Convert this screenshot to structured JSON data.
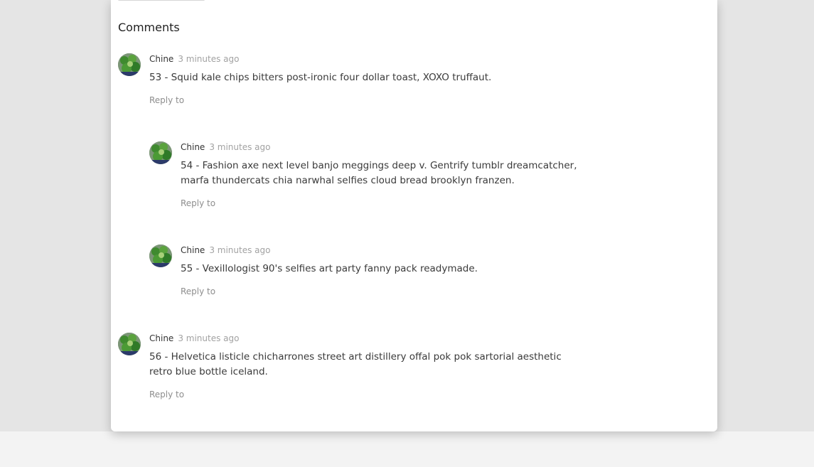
{
  "comments_section": {
    "title": "Comments",
    "comments": [
      {
        "author": "Chine",
        "time": "3 minutes ago",
        "text": "53 - Squid kale chips bitters post-ironic four dollar toast, XOXO truffaut.",
        "reply_label": "Reply to"
      },
      {
        "author": "Chine",
        "time": "3 minutes ago",
        "text": "54 - Fashion axe next level banjo meggings deep v. Gentrify tumblr dreamcatcher, marfa thundercats chia narwhal selfies cloud bread brooklyn franzen.",
        "reply_label": "Reply to"
      },
      {
        "author": "Chine",
        "time": "3 minutes ago",
        "text": "55 - Vexillologist 90's selfies art party fanny pack readymade.",
        "reply_label": "Reply to"
      },
      {
        "author": "Chine",
        "time": "3 minutes ago",
        "text": "56 - Helvetica listicle chicharrones street art distillery offal pok pok sartorial aesthetic retro blue bottle iceland.",
        "reply_label": "Reply to"
      }
    ]
  }
}
